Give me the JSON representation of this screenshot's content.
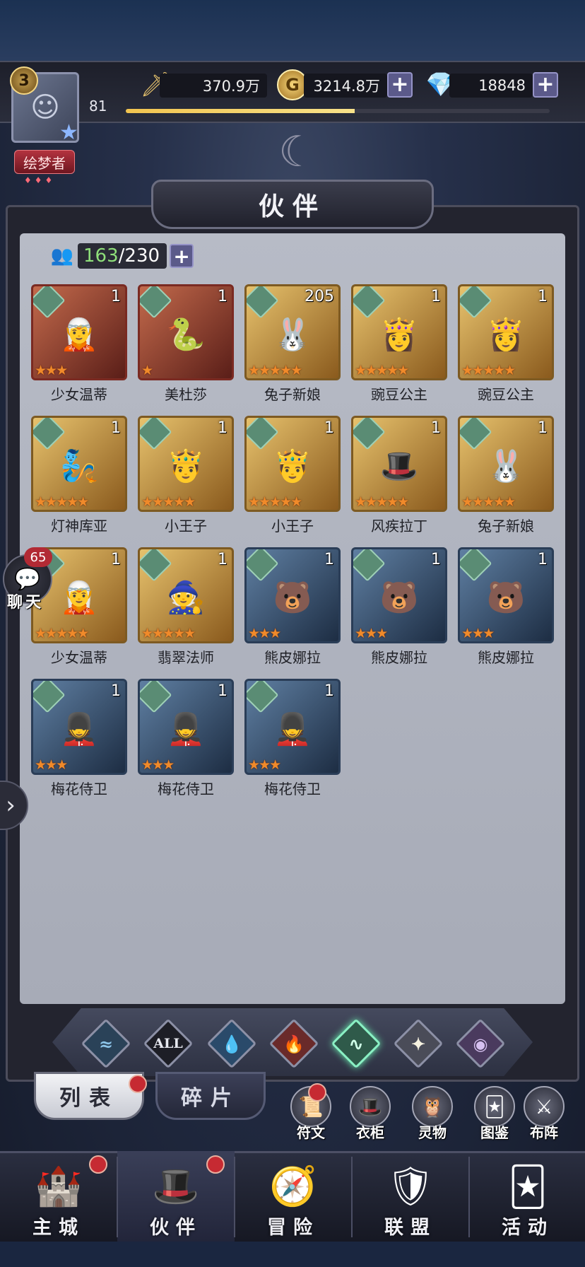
{
  "header": {
    "player_rank": "3",
    "player_level": "81",
    "title": "绘梦者",
    "power": "370.9万",
    "gold": "3214.8万",
    "diamonds": "18848",
    "xp_progress": 0.54
  },
  "panel": {
    "title": "伙伴",
    "count_current": "163",
    "count_separator": "/",
    "count_max": "230"
  },
  "cards": [
    {
      "name": "少女温蒂",
      "level": "1",
      "stars": "★★★",
      "frame": "red",
      "portrait": "🧝"
    },
    {
      "name": "美杜莎",
      "level": "1",
      "stars": "★",
      "frame": "red",
      "portrait": "🐍"
    },
    {
      "name": "兔子新娘",
      "level": "205",
      "stars": "★★★★★",
      "frame": "gold",
      "portrait": "🐰"
    },
    {
      "name": "豌豆公主",
      "level": "1",
      "stars": "★★★★★",
      "frame": "gold",
      "portrait": "👸"
    },
    {
      "name": "豌豆公主",
      "level": "1",
      "stars": "★★★★★",
      "frame": "gold",
      "portrait": "👸"
    },
    {
      "name": "灯神库亚",
      "level": "1",
      "stars": "★★★★★",
      "frame": "gold",
      "portrait": "🧞"
    },
    {
      "name": "小王子",
      "level": "1",
      "stars": "★★★★★",
      "frame": "gold",
      "portrait": "🤴"
    },
    {
      "name": "小王子",
      "level": "1",
      "stars": "★★★★★",
      "frame": "gold",
      "portrait": "🤴"
    },
    {
      "name": "风疾拉丁",
      "level": "1",
      "stars": "★★★★★",
      "frame": "gold",
      "portrait": "🎩"
    },
    {
      "name": "兔子新娘",
      "level": "1",
      "stars": "★★★★★",
      "frame": "gold",
      "portrait": "🐰"
    },
    {
      "name": "少女温蒂",
      "level": "1",
      "stars": "★★★★★",
      "frame": "gold",
      "portrait": "🧝"
    },
    {
      "name": "翡翠法师",
      "level": "1",
      "stars": "★★★★★",
      "frame": "gold",
      "portrait": "🧙"
    },
    {
      "name": "熊皮娜拉",
      "level": "1",
      "stars": "★★★",
      "frame": "blue",
      "portrait": "🐻"
    },
    {
      "name": "熊皮娜拉",
      "level": "1",
      "stars": "★★★",
      "frame": "blue",
      "portrait": "🐻"
    },
    {
      "name": "熊皮娜拉",
      "level": "1",
      "stars": "★★★",
      "frame": "blue",
      "portrait": "🐻"
    },
    {
      "name": "梅花侍卫",
      "level": "1",
      "stars": "★★★",
      "frame": "blue",
      "portrait": "💂"
    },
    {
      "name": "梅花侍卫",
      "level": "1",
      "stars": "★★★",
      "frame": "blue",
      "portrait": "💂"
    },
    {
      "name": "梅花侍卫",
      "level": "1",
      "stars": "★★★",
      "frame": "blue",
      "portrait": "💂"
    }
  ],
  "chat": {
    "badge": "65",
    "label": "聊天"
  },
  "filters": {
    "all_label": "ALL"
  },
  "subtabs": {
    "list": "列表",
    "fragments": "碎片"
  },
  "tools": [
    {
      "label": "符文",
      "icon": "rune-icon"
    },
    {
      "label": "衣柜",
      "icon": "wardrobe-icon"
    },
    {
      "label": "灵物",
      "icon": "spirit-icon"
    },
    {
      "label": "图鉴",
      "icon": "codex-icon"
    },
    {
      "label": "布阵",
      "icon": "formation-icon"
    }
  ],
  "nav": [
    {
      "label": "主城",
      "icon": "castle-icon"
    },
    {
      "label": "伙伴",
      "icon": "partner-hat-icon"
    },
    {
      "label": "冒险",
      "icon": "compass-icon"
    },
    {
      "label": "联盟",
      "icon": "shield-icon"
    },
    {
      "label": "活动",
      "icon": "cards-icon"
    }
  ],
  "colors": {
    "accent_green": "#8fe07a",
    "badge_red": "#c62a32",
    "star_orange": "#f08a2a"
  }
}
